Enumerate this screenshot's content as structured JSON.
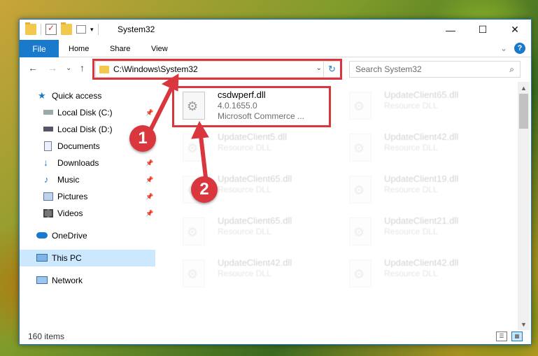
{
  "window": {
    "title": "System32",
    "controls": {
      "minimize": "—",
      "maximize": "☐",
      "close": "✕"
    }
  },
  "ribbon": {
    "tabs": [
      "File",
      "Home",
      "Share",
      "View"
    ],
    "expand_icon": "⌄",
    "help_label": "?"
  },
  "navigation": {
    "back": "←",
    "forward": "→",
    "recent": "⌄",
    "up": "↑"
  },
  "address": {
    "path": "C:\\Windows\\System32",
    "dropdown": "⌄",
    "refresh": "↻"
  },
  "search": {
    "placeholder": "Search System32",
    "icon": "⌕"
  },
  "sidebar": {
    "items": [
      {
        "label": "Quick access",
        "icon": "star-icon",
        "pinned": false
      },
      {
        "label": "Local Disk (C:)",
        "icon": "drive-icon",
        "pinned": true
      },
      {
        "label": "Local Disk (D:)",
        "icon": "drive-icon",
        "pinned": true
      },
      {
        "label": "Documents",
        "icon": "documents-icon",
        "pinned": true
      },
      {
        "label": "Downloads",
        "icon": "downloads-icon",
        "pinned": true
      },
      {
        "label": "Music",
        "icon": "music-icon",
        "pinned": true
      },
      {
        "label": "Pictures",
        "icon": "pictures-icon",
        "pinned": true
      },
      {
        "label": "Videos",
        "icon": "videos-icon",
        "pinned": true
      },
      {
        "label": "OneDrive",
        "icon": "cloud-icon",
        "pinned": false
      },
      {
        "label": "This PC",
        "icon": "computer-icon",
        "pinned": false,
        "selected": true
      },
      {
        "label": "Network",
        "icon": "network-icon",
        "pinned": false
      }
    ],
    "pin_glyph": "📌"
  },
  "files": [
    {
      "name": "csdwperf.dll",
      "line1": "4.0.1655.0",
      "line2": "Microsoft Commerce ...",
      "highlighted": true
    },
    {
      "name": "UpdateClient65.dll",
      "line1": "Resource DLL",
      "line2": ""
    },
    {
      "name": "UpdateClient5.dll",
      "line1": "Resource DLL",
      "line2": ""
    },
    {
      "name": "UpdateClient42.dll",
      "line1": "Resource DLL",
      "line2": ""
    },
    {
      "name": "UpdateClient65.dll",
      "line1": "Resource DLL",
      "line2": ""
    },
    {
      "name": "UpdateClient19.dll",
      "line1": "Resource DLL",
      "line2": ""
    },
    {
      "name": "UpdateClient65.dll",
      "line1": "Resource DLL",
      "line2": ""
    },
    {
      "name": "UpdateClient21.dll",
      "line1": "Resource DLL",
      "line2": ""
    },
    {
      "name": "UpdateClient42.dll",
      "line1": "Resource DLL",
      "line2": ""
    },
    {
      "name": "UpdateClient42.dll",
      "line1": "Resource DLL",
      "line2": ""
    }
  ],
  "status": {
    "item_count": "160 items"
  },
  "annotations": {
    "badge1": "1",
    "badge2": "2",
    "color": "#d9363e"
  }
}
